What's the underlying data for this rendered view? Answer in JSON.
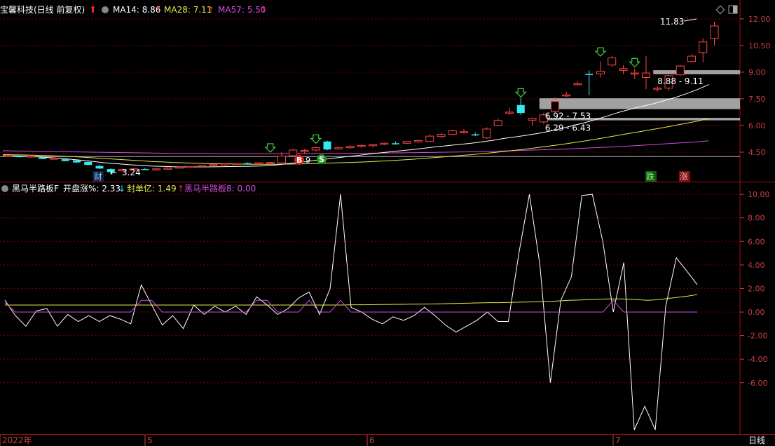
{
  "top_panel": {
    "stock_title": "宝馨科技(日线 前复权)",
    "ma14_label": "MA14: 8.86",
    "ma28_label": "MA28: 7.11",
    "ma57_label": "MA57: 5.50",
    "high_marker": "11.83",
    "low_marker": "3.24",
    "cai_tag": "财",
    "die_tag": "跌",
    "zhang_tag": "涨",
    "b_tag": "B",
    "b_tail": "9",
    "s_tag": "S",
    "zone1_label": "8.88 - 9.11",
    "zone2_label": "6.92 - 7.53",
    "zone3_label": "6.29 - 6.43"
  },
  "bottom_panel": {
    "indicator_name": "黑马半路板F",
    "open_pct_label": "开盘涨%: 2.33",
    "seal_label": "封单亿: 1.49",
    "hm_label": "黑马半路板8: 0.00"
  },
  "x_axis": {
    "labels": [
      "2022年",
      "5",
      "6",
      "7"
    ],
    "period": "日线"
  },
  "colors": {
    "background": "#000000",
    "grid": "#7a0000",
    "axis_text": "#c84040",
    "up": "#ff4545",
    "down": "#38e8f0",
    "ma14": "#ffffff",
    "ma28": "#e8e84a",
    "ma57": "#d44ae0",
    "arrow_green": "#3ed43e",
    "arrow_red": "#ff3030",
    "zone": "#bdbdbd"
  },
  "chart_data": [
    {
      "type": "candlestick",
      "ylim": [
        3.0,
        12.9
      ],
      "yticks": [
        "12.00",
        "10.50",
        "9.00",
        "7.50",
        "6.00",
        "4.50"
      ],
      "candles": [
        [
          4.3,
          4.35,
          4.25,
          4.32
        ],
        [
          4.28,
          4.35,
          4.2,
          4.22
        ],
        [
          4.24,
          4.3,
          4.2,
          4.28
        ],
        [
          4.2,
          4.26,
          4.1,
          4.12
        ],
        [
          4.14,
          4.2,
          4.08,
          4.16
        ],
        [
          4.1,
          4.15,
          3.98,
          4.0
        ],
        [
          4.04,
          4.08,
          3.9,
          3.92
        ],
        [
          3.95,
          4.0,
          3.75,
          3.78
        ],
        [
          3.72,
          3.8,
          3.55,
          3.58
        ],
        [
          3.55,
          3.6,
          3.24,
          3.38
        ],
        [
          3.45,
          3.58,
          3.4,
          3.52
        ],
        [
          3.52,
          3.62,
          3.46,
          3.56
        ],
        [
          3.55,
          3.62,
          3.5,
          3.54
        ],
        [
          3.52,
          3.6,
          3.48,
          3.56
        ],
        [
          3.58,
          3.66,
          3.52,
          3.6
        ],
        [
          3.62,
          3.7,
          3.58,
          3.66
        ],
        [
          3.66,
          3.72,
          3.6,
          3.7
        ],
        [
          3.72,
          3.78,
          3.68,
          3.75
        ],
        [
          3.76,
          3.82,
          3.7,
          3.8
        ],
        [
          3.8,
          3.86,
          3.74,
          3.84
        ],
        [
          3.84,
          3.9,
          3.78,
          3.86
        ],
        [
          3.88,
          3.92,
          3.8,
          3.84
        ],
        [
          3.86,
          3.92,
          3.8,
          3.9
        ],
        [
          3.88,
          3.96,
          3.82,
          3.92
        ],
        [
          3.9,
          4.5,
          3.88,
          4.28
        ],
        [
          4.3,
          4.7,
          4.25,
          4.62
        ],
        [
          4.55,
          4.68,
          4.4,
          4.6
        ],
        [
          4.62,
          4.8,
          4.55,
          4.75
        ],
        [
          5.1,
          5.15,
          4.6,
          4.65
        ],
        [
          4.68,
          4.8,
          4.62,
          4.75
        ],
        [
          4.75,
          4.9,
          4.7,
          4.82
        ],
        [
          4.82,
          4.95,
          4.75,
          4.88
        ],
        [
          4.88,
          4.95,
          4.78,
          4.92
        ],
        [
          4.95,
          5.05,
          4.88,
          5.0
        ],
        [
          5.0,
          5.1,
          4.92,
          4.98
        ],
        [
          5.0,
          5.12,
          4.95,
          5.1
        ],
        [
          5.08,
          5.2,
          5.02,
          5.15
        ],
        [
          5.1,
          5.5,
          5.08,
          5.4
        ],
        [
          5.38,
          5.6,
          5.3,
          5.5
        ],
        [
          5.5,
          5.75,
          5.45,
          5.7
        ],
        [
          5.6,
          5.8,
          5.55,
          5.65
        ],
        [
          5.5,
          5.6,
          5.4,
          5.45
        ],
        [
          5.3,
          5.9,
          5.25,
          5.8
        ],
        [
          6.0,
          6.4,
          5.95,
          6.28
        ],
        [
          6.7,
          7.0,
          6.6,
          6.75
        ],
        [
          7.15,
          7.55,
          6.6,
          6.7
        ],
        [
          6.3,
          6.45,
          6.0,
          6.4
        ],
        [
          6.2,
          6.7,
          6.1,
          6.6
        ],
        [
          6.8,
          7.6,
          6.7,
          7.35
        ],
        [
          7.7,
          7.9,
          7.6,
          7.72
        ],
        [
          8.3,
          8.5,
          8.25,
          8.35
        ],
        [
          8.9,
          9.1,
          7.7,
          8.88
        ],
        [
          8.9,
          9.6,
          8.7,
          9.05
        ],
        [
          9.4,
          9.9,
          9.3,
          9.8
        ],
        [
          9.1,
          9.4,
          8.88,
          9.2
        ],
        [
          8.9,
          9.2,
          8.6,
          8.95
        ],
        [
          8.7,
          9.9,
          8.05,
          8.95
        ],
        [
          8.05,
          8.2,
          7.9,
          8.1
        ],
        [
          8.1,
          8.85,
          7.95,
          8.8
        ],
        [
          8.85,
          9.4,
          8.8,
          9.35
        ],
        [
          9.6,
          10.0,
          9.55,
          9.9
        ],
        [
          10.1,
          10.9,
          9.55,
          10.7
        ],
        [
          10.9,
          11.83,
          10.5,
          11.6
        ]
      ],
      "ma14": [
        4.3,
        4.29,
        4.27,
        4.24,
        4.2,
        4.15,
        4.1,
        4.04,
        3.97,
        3.9,
        3.85,
        3.8,
        3.76,
        3.72,
        3.7,
        3.68,
        3.67,
        3.67,
        3.67,
        3.68,
        3.69,
        3.7,
        3.71,
        3.73,
        3.78,
        3.85,
        3.92,
        4.0,
        4.08,
        4.16,
        4.23,
        4.3,
        4.38,
        4.45,
        4.52,
        4.58,
        4.65,
        4.72,
        4.8,
        4.86,
        4.93,
        4.99,
        5.07,
        5.16,
        5.27,
        5.36,
        5.45,
        5.55,
        5.68,
        5.82,
        5.98,
        6.14,
        6.32,
        6.52,
        6.72,
        6.9,
        7.06,
        7.2,
        7.38,
        7.56,
        7.78,
        8.02,
        8.3
      ],
      "ma28": [
        4.36,
        4.35,
        4.34,
        4.32,
        4.3,
        4.28,
        4.25,
        4.22,
        4.18,
        4.14,
        4.1,
        4.06,
        4.02,
        3.98,
        3.95,
        3.92,
        3.9,
        3.88,
        3.86,
        3.85,
        3.84,
        3.83,
        3.82,
        3.82,
        3.82,
        3.83,
        3.84,
        3.85,
        3.87,
        3.89,
        3.91,
        3.93,
        3.96,
        3.99,
        4.02,
        4.06,
        4.1,
        4.15,
        4.2,
        4.25,
        4.3,
        4.35,
        4.41,
        4.47,
        4.54,
        4.61,
        4.68,
        4.76,
        4.84,
        4.93,
        5.02,
        5.12,
        5.22,
        5.33,
        5.44,
        5.55,
        5.66,
        5.77,
        5.88,
        6.0,
        6.12,
        6.25,
        6.4
      ],
      "ma57": [
        4.58,
        4.57,
        4.56,
        4.55,
        4.54,
        4.53,
        4.52,
        4.51,
        4.5,
        4.49,
        4.48,
        4.47,
        4.46,
        4.45,
        4.44,
        4.43,
        4.43,
        4.42,
        4.42,
        4.41,
        4.41,
        4.41,
        4.41,
        4.41,
        4.41,
        4.41,
        4.42,
        4.42,
        4.42,
        4.43,
        4.43,
        4.44,
        4.44,
        4.45,
        4.46,
        4.46,
        4.47,
        4.48,
        4.49,
        4.5,
        4.51,
        4.52,
        4.54,
        4.55,
        4.57,
        4.59,
        4.61,
        4.63,
        4.65,
        4.67,
        4.69,
        4.72,
        4.75,
        4.78,
        4.81,
        4.84,
        4.88,
        4.92,
        4.96,
        5.0,
        5.04,
        5.08,
        5.14
      ],
      "zones": [
        {
          "from": 8.88,
          "to": 9.11,
          "start_index": 57
        },
        {
          "from": 6.92,
          "to": 7.53,
          "start_index": 47
        },
        {
          "from": 6.29,
          "to": 6.43,
          "start_index": 47
        }
      ],
      "reference_line": 4.25
    },
    {
      "type": "line",
      "ylim": [
        -10.3,
        10.9
      ],
      "yticks": [
        "10.00",
        "8.00",
        "6.00",
        "4.00",
        "2.00",
        "0.00",
        "-2.00",
        "-4.00",
        "-6.00"
      ],
      "series": [
        {
          "name": "开盘涨%",
          "values": [
            1.0,
            -0.3,
            -1.2,
            0.1,
            0.3,
            -1.2,
            -0.2,
            -0.8,
            -0.3,
            -0.8,
            -0.3,
            -0.6,
            -1.0,
            2.3,
            0.6,
            -1.1,
            -0.3,
            -1.4,
            0.6,
            -0.2,
            0.5,
            0.0,
            0.5,
            -0.2,
            1.3,
            0.6,
            -0.2,
            0.3,
            1.2,
            1.7,
            -0.2,
            2.0,
            10.0,
            0.4,
            0.0,
            -0.6,
            -1.0,
            -0.4,
            -0.7,
            -0.3,
            0.4,
            -0.3,
            -1.1,
            -1.7,
            -1.2,
            -0.7,
            0.0,
            -0.8,
            -0.8,
            5.0,
            10.0,
            4.0,
            -6.0,
            1.0,
            3.0,
            9.9,
            10.0,
            6.0,
            0.0,
            4.2,
            -10.0,
            -8.0,
            -10.0,
            0.5,
            4.6,
            3.5,
            2.33
          ]
        },
        {
          "name": "封单亿",
          "values": [
            0.6,
            0.6,
            0.6,
            0.6,
            0.6,
            0.6,
            0.6,
            0.6,
            0.6,
            0.6,
            0.6,
            0.6,
            0.6,
            0.6,
            0.6,
            0.6,
            0.6,
            0.6,
            0.6,
            0.6,
            0.6,
            0.6,
            0.6,
            0.6,
            0.6,
            0.6,
            0.6,
            0.6,
            0.6,
            0.6,
            0.6,
            0.6,
            0.6,
            0.6,
            0.6,
            0.62,
            0.62,
            0.63,
            0.64,
            0.65,
            0.66,
            0.67,
            0.68,
            0.69,
            0.7,
            0.72,
            0.74,
            0.76,
            0.78,
            0.8,
            0.8,
            0.82,
            0.84,
            0.86,
            0.88,
            0.9,
            0.95,
            1.0,
            1.02,
            1.05,
            1.1,
            1.12,
            1.12,
            1.1,
            1.05,
            1.0,
            1.05,
            1.15,
            1.25,
            1.35,
            1.49
          ]
        },
        {
          "name": "黑马半路板8",
          "values": [
            0.8,
            0.0,
            0.0,
            0.0,
            0.0,
            0.0,
            0.0,
            0.0,
            0.0,
            0.0,
            0.0,
            0.0,
            0.0,
            1.0,
            1.0,
            0.0,
            0.0,
            0.0,
            0.0,
            0.0,
            0.0,
            0.0,
            0.0,
            0.0,
            1.0,
            1.0,
            0.0,
            0.0,
            0.0,
            1.0,
            0.0,
            0.0,
            1.0,
            0.0,
            0.0,
            0.0,
            0.0,
            0.0,
            0.0,
            0.0,
            0.0,
            0.0,
            0.0,
            0.0,
            0.0,
            0.0,
            0.0,
            0.0,
            0.0,
            0.0,
            0.0,
            0.0,
            0.0,
            0.0,
            0.0,
            0.0,
            0.0,
            0.0,
            1.0,
            0.0,
            0.0,
            0.0,
            0.0,
            0.0,
            0.0,
            0.0,
            0.0
          ]
        }
      ]
    }
  ]
}
